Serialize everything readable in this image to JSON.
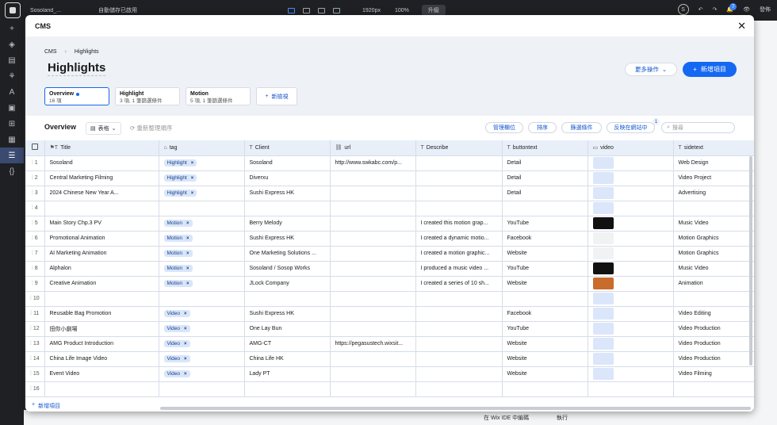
{
  "topbar": {
    "site_name": "Sosoland_...",
    "autosave": "自動儲存已啟用",
    "resolution": "1920px",
    "zoom": "100%",
    "upgrade": "升級",
    "notif_count": "7",
    "publish": "發佈",
    "avatar_initial": "S"
  },
  "bottombar": {
    "ide": "在 Wix IDE 中編碼",
    "run": "執行"
  },
  "modal": {
    "title": "CMS",
    "breadcrumb": [
      "CMS",
      "Highlights"
    ],
    "page_title": "Highlights",
    "more_actions": "更多操作",
    "add_item": "新增項目",
    "views": [
      {
        "name": "Overview",
        "sub": "16 項",
        "active": true
      },
      {
        "name": "Highlight",
        "sub": "3 項, 1 筆篩選條件",
        "active": false
      },
      {
        "name": "Motion",
        "sub": "5 項, 1 筆篩選條件",
        "active": false
      }
    ],
    "new_view": "新檢視"
  },
  "toolbar": {
    "title": "Overview",
    "layout": "表格",
    "reorder": "重新整理順序",
    "manage_fields": "管理欄位",
    "sort": "排序",
    "filter": "篩選條件",
    "reflect_site": "反映在網站中",
    "reflect_badge": "1",
    "search_placeholder": "搜尋"
  },
  "table": {
    "columns": [
      "Title",
      "tag",
      "Client",
      "url",
      "Describe",
      "buttontext",
      "video",
      "sidetext"
    ],
    "rows": [
      {
        "n": "1",
        "title": "Sosoland",
        "tag": "Highlight",
        "client": "Sosoland",
        "url": "http://www.swkabc.com/p...",
        "describe": "",
        "button": "Detail",
        "video": "blue",
        "side": "Web Design"
      },
      {
        "n": "2",
        "title": "Central Marketing Filming",
        "tag": "Highlight",
        "client": "Diverxu",
        "url": "",
        "describe": "",
        "button": "Detail",
        "video": "blue",
        "side": "Video Project"
      },
      {
        "n": "3",
        "title": "2024 Chinese New Year A...",
        "tag": "Highlight",
        "client": "Sushi Express HK",
        "url": "",
        "describe": "",
        "button": "Detail",
        "video": "blue",
        "side": "Advertising"
      },
      {
        "n": "4",
        "title": "",
        "tag": "",
        "client": "",
        "url": "",
        "describe": "",
        "button": "",
        "video": "blue",
        "side": ""
      },
      {
        "n": "5",
        "title": "Main Story Chp.3 PV",
        "tag": "Motion",
        "client": "Berry Melody",
        "url": "",
        "describe": "I created this motion grap...",
        "button": "YouTube",
        "video": "dark",
        "side": "Music Video"
      },
      {
        "n": "6",
        "title": "Promotional Animation",
        "tag": "Motion",
        "client": "Sushi Express HK",
        "url": "",
        "describe": "I created a dynamic motio...",
        "button": "Facebook",
        "video": "light",
        "side": "Motion Graphics"
      },
      {
        "n": "7",
        "title": "AI Marketing Animation",
        "tag": "Motion",
        "client": "One Marketing Solutions ...",
        "url": "",
        "describe": "I created a motion graphic...",
        "button": "Website",
        "video": "light",
        "side": "Motion Graphics"
      },
      {
        "n": "8",
        "title": "Alphalon",
        "tag": "Motion",
        "client": "Sosoland / Sosop Works",
        "url": "",
        "describe": "I produced a music video ...",
        "button": "YouTube",
        "video": "dark",
        "side": "Music Video"
      },
      {
        "n": "9",
        "title": "Creative Animation",
        "tag": "Motion",
        "client": "JLock Company",
        "url": "",
        "describe": "I created a series of 10 sh...",
        "button": "Website",
        "video": "orange",
        "side": "Animation"
      },
      {
        "n": "10",
        "title": "",
        "tag": "",
        "client": "",
        "url": "",
        "describe": "",
        "button": "",
        "video": "blue",
        "side": ""
      },
      {
        "n": "11",
        "title": "Reusable Bag Promotion",
        "tag": "Video",
        "client": "Sushi Express HK",
        "url": "",
        "describe": "",
        "button": "Facebook",
        "video": "blue",
        "side": "Video Editing"
      },
      {
        "n": "12",
        "title": "扭你小劇場",
        "tag": "Video",
        "client": "One Lay Bun",
        "url": "",
        "describe": "",
        "button": "YouTube",
        "video": "blue",
        "side": "Video Production"
      },
      {
        "n": "13",
        "title": "AMG Product Introduction",
        "tag": "Video",
        "client": "AMG-CT",
        "url": "https://pegasustech.wixsit...",
        "describe": "",
        "button": "Website",
        "video": "blue",
        "side": "Video Production"
      },
      {
        "n": "14",
        "title": "China Life Image Video",
        "tag": "Video",
        "client": "China Life HK",
        "url": "",
        "describe": "",
        "button": "Website",
        "video": "blue",
        "side": "Video Production"
      },
      {
        "n": "15",
        "title": "Event Video",
        "tag": "Video",
        "client": "Lady PT",
        "url": "",
        "describe": "",
        "button": "Website",
        "video": "blue",
        "side": "Video Filming"
      },
      {
        "n": "16",
        "title": "",
        "tag": "",
        "client": "",
        "url": "",
        "describe": "",
        "button": "",
        "video": "",
        "side": ""
      }
    ],
    "add_row": "新增項目"
  }
}
